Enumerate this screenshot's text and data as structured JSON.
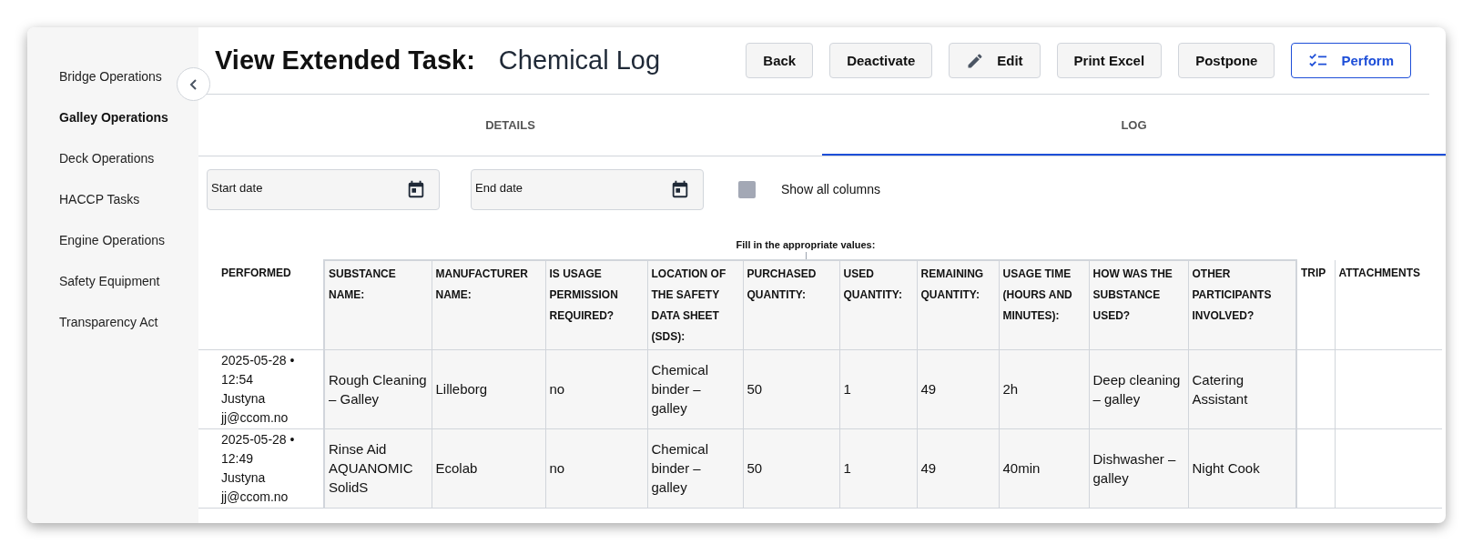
{
  "sidebar": {
    "items": [
      {
        "label": "Bridge Operations",
        "selected": false
      },
      {
        "label": "Galley Operations",
        "selected": true
      },
      {
        "label": "Deck Operations",
        "selected": false
      },
      {
        "label": "HACCP Tasks",
        "selected": false
      },
      {
        "label": "Engine Operations",
        "selected": false
      },
      {
        "label": "Safety Equipment",
        "selected": false
      },
      {
        "label": "Transparency Act",
        "selected": false
      }
    ]
  },
  "header": {
    "title": "View Extended Task:",
    "subtitle": "Chemical Log",
    "buttons": [
      {
        "label": "Back",
        "kind": "plain"
      },
      {
        "label": "Deactivate",
        "kind": "plain"
      },
      {
        "label": "Edit",
        "kind": "edit"
      },
      {
        "label": "Print Excel",
        "kind": "plain"
      },
      {
        "label": "Postpone",
        "kind": "plain"
      },
      {
        "label": "Perform",
        "kind": "primary"
      }
    ]
  },
  "tabs": [
    {
      "label": "DETAILS",
      "selected": false
    },
    {
      "label": "LOG",
      "selected": true
    }
  ],
  "filters": {
    "start_date": {
      "label": "Start date"
    },
    "end_date": {
      "label": "End date"
    },
    "show_all_columns": {
      "label": "Show all columns",
      "checked": false
    }
  },
  "table": {
    "group_label": "Fill in the appropriate values:",
    "columns": [
      {
        "label": "PERFORMED",
        "in_group": false
      },
      {
        "label": "SUBSTANCE NAME:",
        "in_group": true
      },
      {
        "label": "MANUFACTURER NAME:",
        "in_group": true
      },
      {
        "label": "IS USAGE PERMISSION REQUIRED?",
        "in_group": true
      },
      {
        "label": "LOCATION OF THE SAFETY DATA SHEET (SDS):",
        "in_group": true
      },
      {
        "label": "PURCHASED QUANTITY:",
        "in_group": true
      },
      {
        "label": "USED QUANTITY:",
        "in_group": true
      },
      {
        "label": "REMAINING QUANTITY:",
        "in_group": true
      },
      {
        "label": "USAGE TIME (HOURS AND MINUTES):",
        "in_group": true
      },
      {
        "label": "HOW WAS THE SUBSTANCE USED?",
        "in_group": true
      },
      {
        "label": "OTHER PARTICIPANTS INVOLVED?",
        "in_group": true
      },
      {
        "label": "TRIP",
        "in_group": false
      },
      {
        "label": "ATTACHMENTS",
        "in_group": false
      }
    ],
    "rows": [
      {
        "cells": [
          "2025-05-28 • 12:54\nJustyna\njj@ccom.no",
          "Rough Cleaning – Galley",
          "Lilleborg",
          "no",
          "Chemical binder – galley",
          "50",
          "1",
          "49",
          "2h",
          "Deep cleaning – galley",
          "Catering Assistant",
          "",
          ""
        ]
      },
      {
        "cells": [
          "2025-05-28 • 12:49\nJustyna\njj@ccom.no",
          "Rinse Aid AQUANOMIC SolidS",
          "Ecolab",
          "no",
          "Chemical binder – galley",
          "50",
          "1",
          "49",
          "40min",
          "Dishwasher – galley",
          "Night Cook",
          "",
          ""
        ]
      }
    ]
  }
}
